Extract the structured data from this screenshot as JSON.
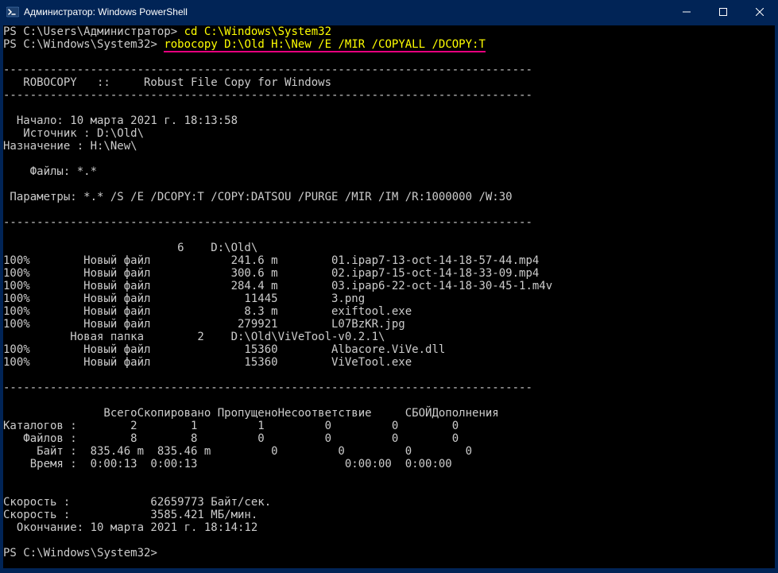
{
  "window": {
    "title": "Администратор: Windows PowerShell"
  },
  "prompt1": {
    "ps": "PS ",
    "path": "C:\\Users\\Администратор> ",
    "cmd": "cd C:\\Windows\\System32"
  },
  "prompt2": {
    "ps": "PS ",
    "path": "C:\\Windows\\System32> ",
    "cmd": "robocopy D:\\Old H:\\New /E /MIR /COPYALL /DCOPY:T"
  },
  "dashes": "-------------------------------------------------------------------------------",
  "header": "   ROBOCOPY   ::     Robust File Copy for Windows",
  "start": "  Начало: 10 марта 2021 г. 18:13:58",
  "source": "   Источник : D:\\Old\\",
  "dest": "Назначение : H:\\New\\",
  "files": "    Файлы: *.*",
  "params": " Параметры: *.* /S /E /DCOPY:T /COPY:DATSOU /PURGE /MIR /IM /R:1000000 /W:30",
  "dir1": "                          6    D:\\Old\\",
  "f1": "100%        Новый файл            241.6 m        01.ipap7-13-oct-14-18-57-44.mp4",
  "f2": "100%        Новый файл            300.6 m        02.ipap7-15-oct-14-18-33-09.mp4",
  "f3": "100%        Новый файл            284.4 m        03.ipap6-22-oct-14-18-30-45-1.m4v",
  "f4": "100%        Новый файл              11445        3.png",
  "f5": "100%        Новый файл              8.3 m        exiftool.exe",
  "f6": "100%        Новый файл             279921        L07BzKR.jpg",
  "dir2": "          Новая папка        2    D:\\Old\\ViVeTool-v0.2.1\\",
  "f7": "100%        Новый файл              15360        Albacore.ViVe.dll",
  "f8": "100%        Новый файл              15360        ViVeTool.exe",
  "sumhdr": "               ВсегоСкопировано ПропущеноНесоответствие     СБОЙДополнения",
  "sum1": "Каталогов :        2        1         1         0         0        0",
  "sum2": "   Файлов :        8        8         0         0         0        0",
  "sum3": "     Байт :  835.46 m  835.46 m         0         0         0        0",
  "sum4": "    Время :  0:00:13  0:00:13                      0:00:00  0:00:00",
  "speed1": "Скорость :            62659773 Байт/сек.",
  "speed2": "Скорость :            3585.421 МБ/мин.",
  "end": "  Окончание: 10 марта 2021 г. 18:14:12",
  "prompt3": {
    "ps": "PS ",
    "path": "C:\\Windows\\System32> "
  }
}
